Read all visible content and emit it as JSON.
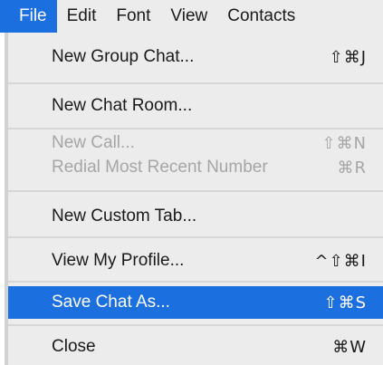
{
  "menubar": {
    "items": [
      {
        "label": "File"
      },
      {
        "label": "Edit"
      },
      {
        "label": "Font"
      },
      {
        "label": "View"
      },
      {
        "label": "Contacts"
      }
    ]
  },
  "file_menu": {
    "items": [
      {
        "label": "New Group Chat...",
        "shortcut": "⇧⌘J"
      },
      {
        "label": "New Chat Room...",
        "shortcut": ""
      },
      {
        "label": "New Call...",
        "shortcut": "⇧⌘N"
      },
      {
        "label": "Redial Most Recent Number",
        "shortcut": "⌘R"
      },
      {
        "label": "New Custom Tab...",
        "shortcut": ""
      },
      {
        "label": "View My Profile...",
        "shortcut": "^⇧⌘I"
      },
      {
        "label": "Save Chat As...",
        "shortcut": "⇧⌘S"
      },
      {
        "label": "Close",
        "shortcut": "⌘W"
      }
    ]
  },
  "colors": {
    "highlight": "#1c6fde",
    "menu_background": "#ececec",
    "disabled_text": "#a6a6a6",
    "separator": "#d6d6d6"
  }
}
